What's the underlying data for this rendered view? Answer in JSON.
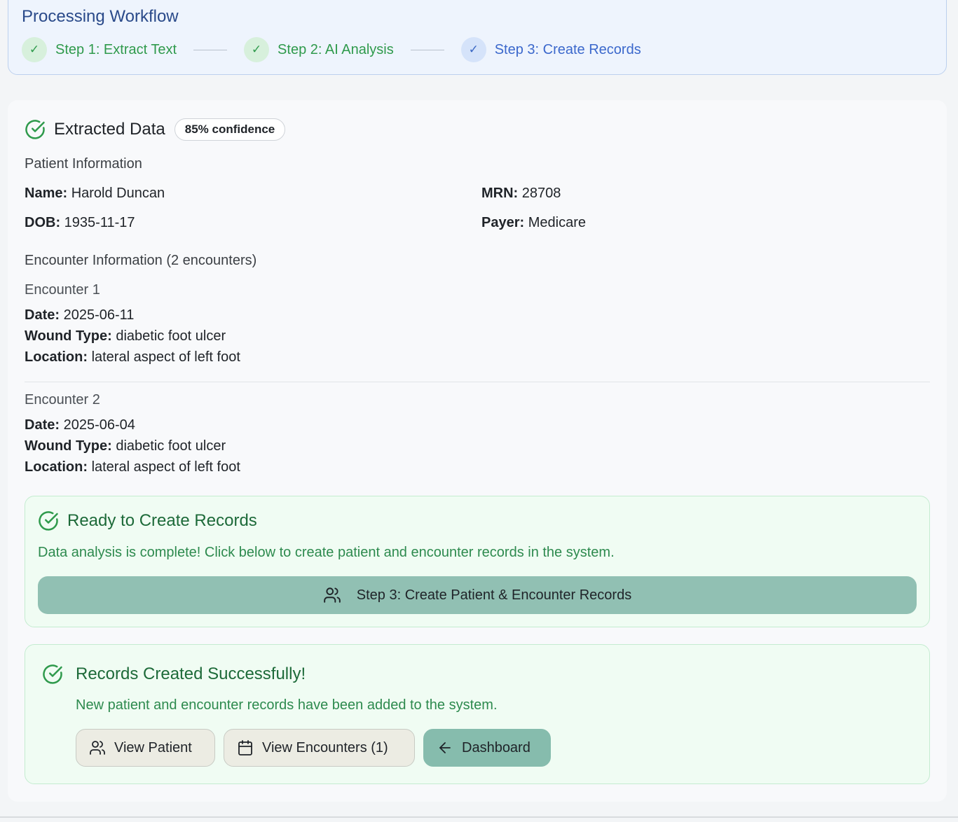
{
  "workflow": {
    "title": "Processing Workflow",
    "steps": [
      {
        "label": "Step 1: Extract Text",
        "status": "done"
      },
      {
        "label": "Step 2: AI Analysis",
        "status": "done"
      },
      {
        "label": "Step 3: Create Records",
        "status": "active"
      }
    ],
    "check_glyph": "✓"
  },
  "extracted": {
    "title": "Extracted Data",
    "confidence": "85% confidence",
    "patient_section": "Patient Information",
    "name_label": "Name:",
    "name_value": "Harold Duncan",
    "mrn_label": "MRN:",
    "mrn_value": "28708",
    "dob_label": "DOB:",
    "dob_value": "1935-11-17",
    "payer_label": "Payer:",
    "payer_value": "Medicare",
    "encounter_section": "Encounter Information (2 encounters)",
    "encounters": [
      {
        "title": "Encounter 1",
        "date_label": "Date:",
        "date": "2025-06-11",
        "wound_label": "Wound Type:",
        "wound": "diabetic foot ulcer",
        "location_label": "Location:",
        "location": "lateral aspect of left foot"
      },
      {
        "title": "Encounter 2",
        "date_label": "Date:",
        "date": "2025-06-04",
        "wound_label": "Wound Type:",
        "wound": "diabetic foot ulcer",
        "location_label": "Location:",
        "location": "lateral aspect of left foot"
      }
    ]
  },
  "ready": {
    "title": "Ready to Create Records",
    "text": "Data analysis is complete! Click below to create patient and encounter records in the system.",
    "button": "Step 3: Create Patient & Encounter Records"
  },
  "success": {
    "title": "Records Created Successfully!",
    "text": "New patient and encounter records have been added to the system.",
    "view_patient": "View Patient",
    "view_encounters": "View Encounters (1)",
    "dashboard": "Dashboard"
  },
  "colors": {
    "accent_green": "#2f9a4c",
    "accent_blue": "#3b68cc",
    "button_teal": "#91c0b3"
  },
  "icons": [
    "check-icon",
    "check-circle-icon",
    "users-icon",
    "calendar-icon",
    "arrow-left-icon"
  ]
}
